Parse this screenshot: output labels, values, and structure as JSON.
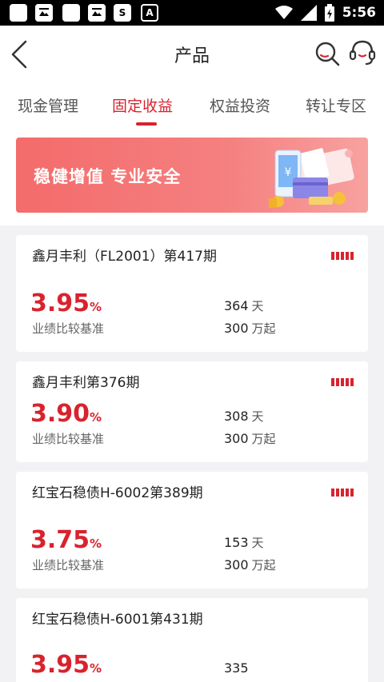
{
  "status_bar": {
    "time": "5:56",
    "left_icons": [
      "square-icon",
      "gallery-icon",
      "square-icon",
      "gallery-icon",
      "s-app-icon",
      "a-app-icon"
    ],
    "right_icons": [
      "wifi-icon",
      "signal-icon",
      "battery-icon"
    ]
  },
  "header": {
    "title": "产品"
  },
  "tabs": [
    {
      "label": "现金管理",
      "active": false
    },
    {
      "label": "固定收益",
      "active": true
    },
    {
      "label": "权益投资",
      "active": false
    },
    {
      "label": "转让专区",
      "active": false
    }
  ],
  "banner": {
    "text": "稳健增值 专业安全"
  },
  "products": [
    {
      "name": "鑫月丰利（FL2001）第417期",
      "rate": "3.95",
      "rate_unit": "%",
      "rate_label": "业绩比较基准",
      "term_value": "364",
      "term_unit": "天",
      "min_value": "300",
      "min_unit": "万起",
      "risk_level": "risk-level-icon"
    },
    {
      "name": "鑫月丰利第376期",
      "rate": "3.90",
      "rate_unit": "%",
      "rate_label": "业绩比较基准",
      "term_value": "308",
      "term_unit": "天",
      "min_value": "300",
      "min_unit": "万起",
      "risk_level": "risk-level-icon"
    },
    {
      "name": "红宝石稳债H-6002第389期",
      "rate": "3.75",
      "rate_unit": "%",
      "rate_label": "业绩比较基准",
      "term_value": "153",
      "term_unit": "天",
      "min_value": "300",
      "min_unit": "万起",
      "risk_level": "risk-level-icon"
    },
    {
      "name": "红宝石稳债H-6001第431期",
      "rate": "3.95",
      "rate_unit": "%",
      "term_value": "335"
    }
  ],
  "colors": {
    "accent": "#d8232e",
    "banner_start": "#f46b6b",
    "banner_end": "#f7a2a0"
  }
}
